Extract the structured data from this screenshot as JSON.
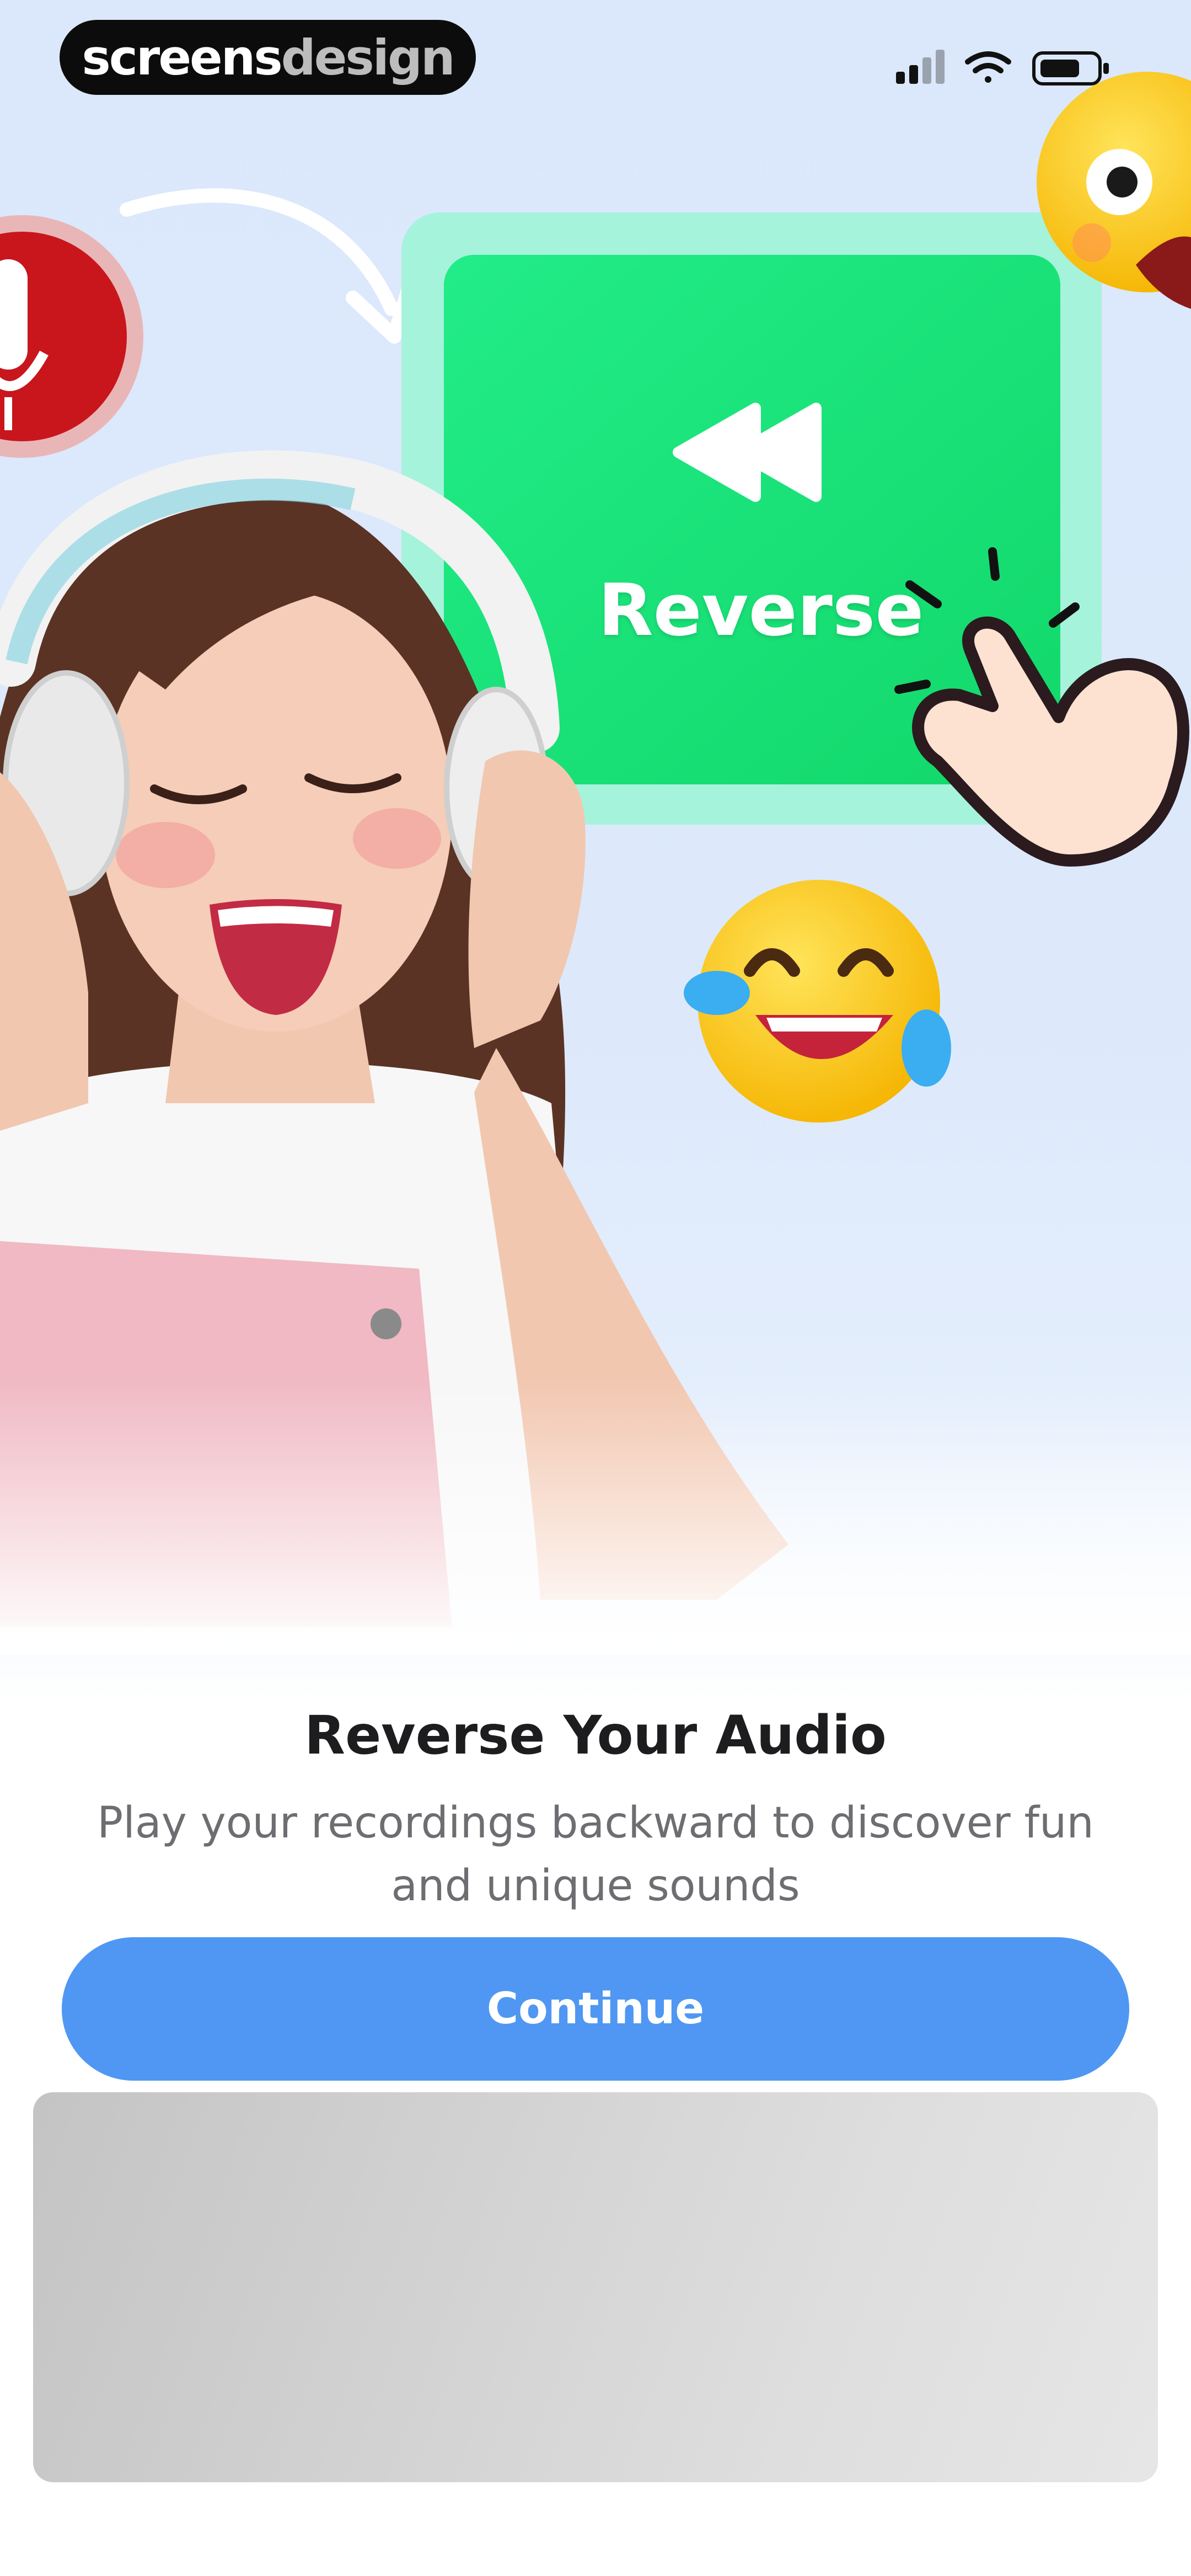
{
  "watermark": {
    "part1": "screens",
    "part2": "design"
  },
  "status_bar": {
    "signal_icon": "cellular-signal-icon",
    "wifi_icon": "wifi-icon",
    "battery_icon": "battery-icon"
  },
  "hero": {
    "card_label": "Reverse",
    "card_icon": "rewind-icon",
    "mic_icon": "microphone-icon",
    "emoji_top": "winking-face-emoji",
    "emoji_middle": "tears-of-joy-emoji",
    "hand_icon": "pointing-hand-icon",
    "colors": {
      "card_green": "#1ee37a",
      "card_frame": "#a6f3dc",
      "mic_red": "#c8161c",
      "button_blue": "#4f97f2"
    }
  },
  "onboarding": {
    "title": "Reverse Your Audio",
    "subtitle": "Play your recordings backward to discover fun and unique sounds",
    "continue_label": "Continue"
  }
}
